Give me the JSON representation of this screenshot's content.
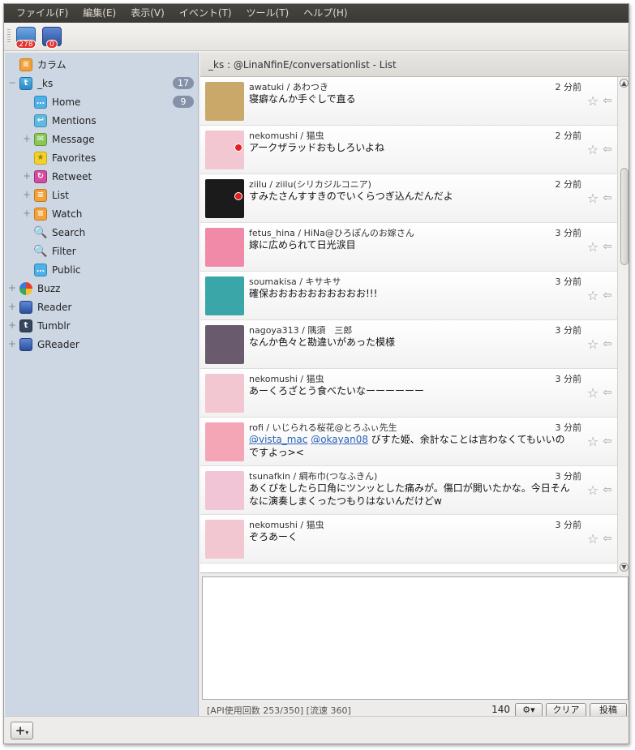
{
  "menu": [
    "ファイル(F)",
    "編集(E)",
    "表示(V)",
    "イベント(T)",
    "ツール(T)",
    "ヘルプ(H)"
  ],
  "toolbar": {
    "buttons": [
      {
        "icon": "twitter-calendar-icon",
        "badge": "278"
      },
      {
        "icon": "rss-icon",
        "badge": "0"
      }
    ]
  },
  "sidebar": {
    "items": [
      {
        "label": "カラム",
        "icon": "column-icon",
        "level": 0,
        "expander": ""
      },
      {
        "label": "_ks",
        "icon": "twitter-icon",
        "level": 0,
        "expander": "−",
        "count": "17"
      },
      {
        "label": "Home",
        "icon": "home-bubble-icon",
        "level": 1,
        "expander": "",
        "count": "9"
      },
      {
        "label": "Mentions",
        "icon": "mentions-icon",
        "level": 1,
        "expander": ""
      },
      {
        "label": "Message",
        "icon": "message-icon",
        "level": 1,
        "expander": "+"
      },
      {
        "label": "Favorites",
        "icon": "favorites-icon",
        "level": 1,
        "expander": ""
      },
      {
        "label": "Retweet",
        "icon": "retweet-icon",
        "level": 1,
        "expander": "+"
      },
      {
        "label": "List",
        "icon": "list-icon",
        "level": 1,
        "expander": "+"
      },
      {
        "label": "Watch",
        "icon": "watch-icon",
        "level": 1,
        "expander": "+"
      },
      {
        "label": "Search",
        "icon": "search-icon",
        "level": 1,
        "expander": ""
      },
      {
        "label": "Filter",
        "icon": "filter-icon",
        "level": 1,
        "expander": ""
      },
      {
        "label": "Public",
        "icon": "public-bubble-icon",
        "level": 1,
        "expander": ""
      },
      {
        "label": "Buzz",
        "icon": "buzz-icon",
        "level": 0,
        "expander": "+"
      },
      {
        "label": "Reader",
        "icon": "reader-rss-icon",
        "level": 0,
        "expander": "+"
      },
      {
        "label": "Tumblr",
        "icon": "tumblr-icon",
        "level": 0,
        "expander": "+"
      },
      {
        "label": "GReader",
        "icon": "greader-rss-icon",
        "level": 0,
        "expander": "+"
      }
    ]
  },
  "list": {
    "title": "_ks : @LinaNfinE/conversationlist - List",
    "tweets": [
      {
        "user": "awatuki / あわつき",
        "time": "2 分前",
        "text": "寝癖なんか手ぐしで直る",
        "avatar_color": "#c9a86a",
        "online": false
      },
      {
        "user": "nekomushi / 猫虫",
        "time": "2 分前",
        "text": "アークザラッドおもしろいよね",
        "avatar_color": "#f3c7d2",
        "online": true
      },
      {
        "user": "ziilu / ziilu(シリカジルコニア)",
        "time": "2 分前",
        "text": "すみたさんすすきのでいくらつぎ込んだんだよ",
        "avatar_color": "#1b1b1b",
        "online": true
      },
      {
        "user": "fetus_hina / HiNa@ひろぽんのお嫁さん",
        "time": "3 分前",
        "text": "嫁に広められて日光涙目",
        "avatar_color": "#f08aa8",
        "online": false
      },
      {
        "user": "soumakisa / キサキサ",
        "time": "3 分前",
        "text": "確保おおおおおおおおおお!!!",
        "avatar_color": "#3aa6a8",
        "online": false
      },
      {
        "user": "nagoya313 / 隅須　三郎",
        "time": "3 分前",
        "text": "なんか色々と勘違いがあった模様",
        "avatar_color": "#6a5a6e",
        "online": false
      },
      {
        "user": "nekomushi / 猫虫",
        "time": "3 分前",
        "text": "あーくろざとう食べたいなーーーーーー",
        "avatar_color": "#f3c7d2",
        "online": false
      },
      {
        "user": "rofi / いじられる桜花@とろふぃ先生",
        "time": "3 分前",
        "mention1": "@vista_mac",
        "mention2": "@okayan08",
        "text": " びすた姫、余計なことは言わなくてもいいのですよっ><",
        "avatar_color": "#f4a6b6",
        "online": false
      },
      {
        "user": "tsunafkin / 綱布巾(つなふきん)",
        "time": "3 分前",
        "text": "あくびをしたら口角にツンッとした痛みが。傷口が開いたかな。今日そんなに演奏しまくったつもりはないんだけどw",
        "avatar_color": "#f2c5d6",
        "online": false
      },
      {
        "user": "nekomushi / 猫虫",
        "time": "3 分前",
        "text": "ぞろあーく",
        "avatar_color": "#f3c7d2",
        "online": false
      }
    ]
  },
  "status": {
    "api": "[API使用回数 253/350] [流速 360]",
    "char_count": "140",
    "clear_label": "クリア",
    "post_label": "投稿",
    "settings_icon": "gear-icon"
  },
  "bottom": {
    "add_label": "+"
  }
}
